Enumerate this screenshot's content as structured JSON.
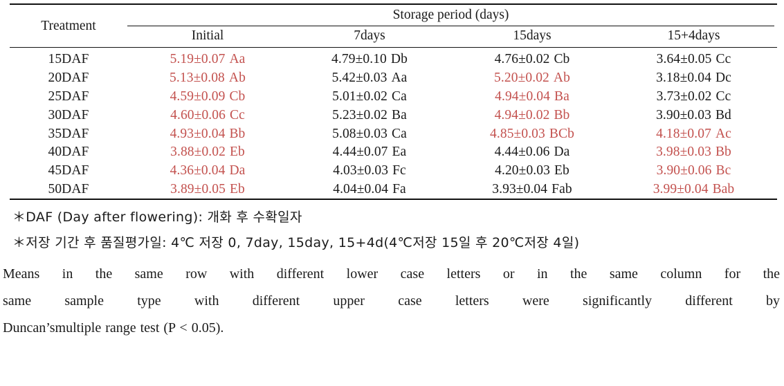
{
  "table": {
    "corner_label": "Treatment",
    "group_header": "Storage period (days)",
    "columns": [
      "Initial",
      "7days",
      "15days",
      "15+4days"
    ],
    "rows": [
      {
        "treatment": "15DAF",
        "cells": [
          {
            "value": "5.19±0.07",
            "letters": "Aa",
            "color": "red"
          },
          {
            "value": "4.79±0.10",
            "letters": "Db",
            "color": "black"
          },
          {
            "value": "4.76±0.02",
            "letters": "Cb",
            "color": "black"
          },
          {
            "value": "3.64±0.05",
            "letters": "Cc",
            "color": "black"
          }
        ]
      },
      {
        "treatment": "20DAF",
        "cells": [
          {
            "value": "5.13±0.08",
            "letters": "Ab",
            "color": "red"
          },
          {
            "value": "5.42±0.03",
            "letters": "Aa",
            "color": "black"
          },
          {
            "value": "5.20±0.02",
            "letters": "Ab",
            "color": "red"
          },
          {
            "value": "3.18±0.04",
            "letters": "Dc",
            "color": "black"
          }
        ]
      },
      {
        "treatment": "25DAF",
        "cells": [
          {
            "value": "4.59±0.09",
            "letters": "Cb",
            "color": "red"
          },
          {
            "value": "5.01±0.02",
            "letters": "Ca",
            "color": "black"
          },
          {
            "value": "4.94±0.04",
            "letters": "Ba",
            "color": "red"
          },
          {
            "value": "3.73±0.02",
            "letters": "Cc",
            "color": "black"
          }
        ]
      },
      {
        "treatment": "30DAF",
        "cells": [
          {
            "value": "4.60±0.06",
            "letters": "Cc",
            "color": "red"
          },
          {
            "value": "5.23±0.02",
            "letters": "Ba",
            "color": "black"
          },
          {
            "value": "4.94±0.02",
            "letters": "Bb",
            "color": "red"
          },
          {
            "value": "3.90±0.03",
            "letters": "Bd",
            "color": "black"
          }
        ]
      },
      {
        "treatment": "35DAF",
        "cells": [
          {
            "value": "4.93±0.04",
            "letters": "Bb",
            "color": "red"
          },
          {
            "value": "5.08±0.03",
            "letters": "Ca",
            "color": "black"
          },
          {
            "value": "4.85±0.03",
            "letters": "BCb",
            "color": "red"
          },
          {
            "value": "4.18±0.07",
            "letters": "Ac",
            "color": "red"
          }
        ]
      },
      {
        "treatment": "40DAF",
        "cells": [
          {
            "value": "3.88±0.02",
            "letters": "Eb",
            "color": "red"
          },
          {
            "value": "4.44±0.07",
            "letters": "Ea",
            "color": "black"
          },
          {
            "value": "4.44±0.06",
            "letters": "Da",
            "color": "black"
          },
          {
            "value": "3.98±0.03",
            "letters": "Bb",
            "color": "red"
          }
        ]
      },
      {
        "treatment": "45DAF",
        "cells": [
          {
            "value": "4.36±0.04",
            "letters": "Da",
            "color": "red"
          },
          {
            "value": "4.03±0.03",
            "letters": "Fc",
            "color": "black"
          },
          {
            "value": "4.20±0.03",
            "letters": "Eb",
            "color": "black"
          },
          {
            "value": "3.90±0.06",
            "letters": "Bc",
            "color": "red"
          }
        ]
      },
      {
        "treatment": "50DAF",
        "cells": [
          {
            "value": "3.89±0.05",
            "letters": "Eb",
            "color": "red"
          },
          {
            "value": "4.04±0.04",
            "letters": "Fa",
            "color": "black"
          },
          {
            "value": "3.93±0.04",
            "letters": "Fab",
            "color": "black"
          },
          {
            "value": "3.99±0.04",
            "letters": "Bab",
            "color": "red"
          }
        ]
      }
    ]
  },
  "notes": {
    "note_daf": "＊DAF (Day after flowering): 개화 후 수확일자",
    "note_storage": "＊저장 기간 후 품질평가일:  4℃ 저장 0, 7day, 15day, 15+4d(4℃저장 15일 후 20℃저장 4일)",
    "paragraph_lines": [
      "Means in the same row with different lower case letters or in the same column for the",
      "same sample type with different upper case letters were significantly different by",
      "Duncan’smultiple range test (P < 0.05)."
    ]
  },
  "colors": {
    "red": "#c3514e",
    "black": "#1a1a1a",
    "rule": "#111111"
  }
}
